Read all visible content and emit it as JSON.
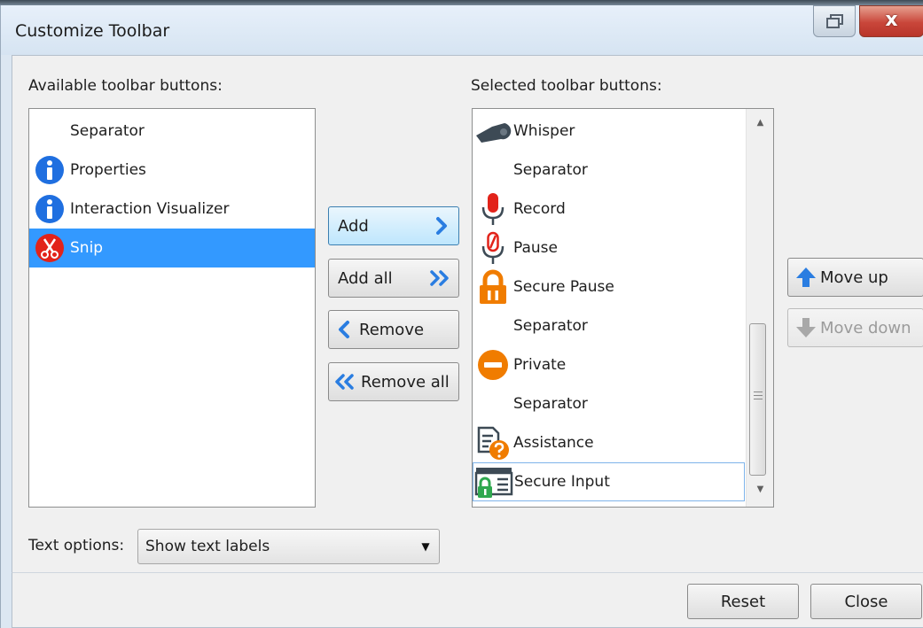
{
  "window": {
    "title": "Customize Toolbar",
    "close_glyph": "x",
    "restore_icon": "restore-window-icon"
  },
  "available": {
    "label": "Available toolbar buttons:",
    "items": [
      {
        "label": "Separator",
        "icon": "none"
      },
      {
        "label": "Properties",
        "icon": "info-icon"
      },
      {
        "label": "Interaction Visualizer",
        "icon": "info-icon"
      },
      {
        "label": "Snip",
        "icon": "scissors-icon",
        "selected": true
      }
    ]
  },
  "selected": {
    "label": "Selected toolbar buttons:",
    "items": [
      {
        "label": "Whisper",
        "icon": "whistle-icon"
      },
      {
        "label": "Separator",
        "icon": "none"
      },
      {
        "label": "Record",
        "icon": "microphone-icon"
      },
      {
        "label": "Pause",
        "icon": "microphone-paused-icon"
      },
      {
        "label": "Secure Pause",
        "icon": "padlock-icon"
      },
      {
        "label": "Separator",
        "icon": "none"
      },
      {
        "label": "Private",
        "icon": "minus-circle-icon"
      },
      {
        "label": "Separator",
        "icon": "none"
      },
      {
        "label": "Assistance",
        "icon": "document-question-icon"
      },
      {
        "label": "Secure Input",
        "icon": "secure-input-icon",
        "focused": true
      }
    ]
  },
  "transfer_buttons": {
    "add": "Add",
    "add_all": "Add all",
    "remove": "Remove",
    "remove_all": "Remove all"
  },
  "order_buttons": {
    "move_up": "Move up",
    "move_down": "Move down"
  },
  "text_options": {
    "label": "Text options:",
    "value": "Show text labels"
  },
  "footer": {
    "reset": "Reset",
    "close": "Close"
  },
  "colors": {
    "info_blue": "#1f6fe0",
    "record_red": "#e2231a",
    "accent_orange": "#f07c00",
    "selection_blue": "#3399ff",
    "secure_green": "#2fa84f"
  }
}
